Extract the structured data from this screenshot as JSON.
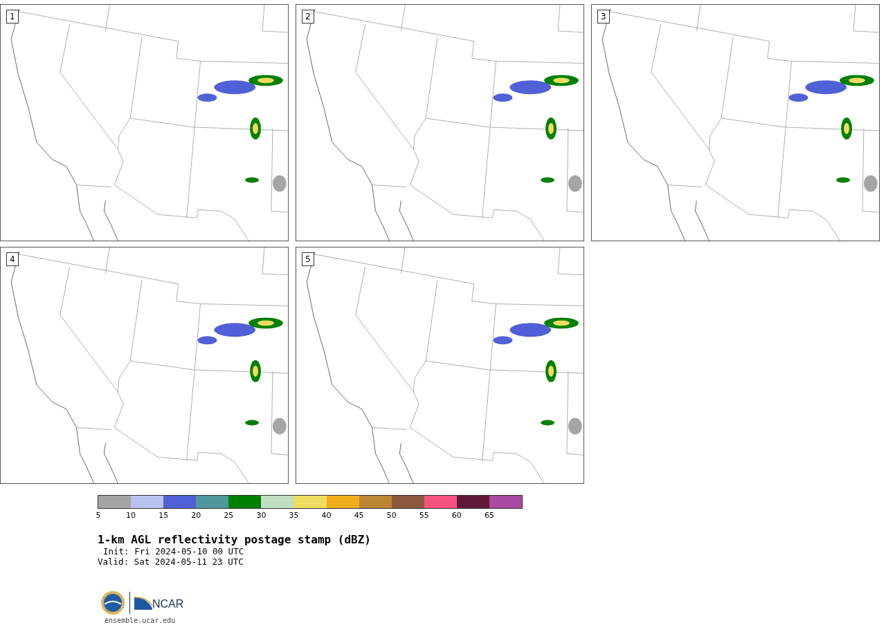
{
  "panels": [
    {
      "number": "1"
    },
    {
      "number": "2"
    },
    {
      "number": "3"
    },
    {
      "number": "4"
    },
    {
      "number": "5"
    }
  ],
  "colorbar": {
    "segments": [
      {
        "color": "#a5a5a5",
        "label": "5"
      },
      {
        "color": "#b8c2ee",
        "label": "10"
      },
      {
        "color": "#5060d6",
        "label": "15"
      },
      {
        "color": "#50979b",
        "label": "20"
      },
      {
        "color": "#008000",
        "label": "25"
      },
      {
        "color": "#c0dfc0",
        "label": "30"
      },
      {
        "color": "#f0dc60",
        "label": "35"
      },
      {
        "color": "#f0ae1a",
        "label": "40"
      },
      {
        "color": "#bb8533",
        "label": "45"
      },
      {
        "color": "#8b5a3e",
        "label": "50"
      },
      {
        "color": "#f55280",
        "label": "55"
      },
      {
        "color": "#611838",
        "label": "60"
      },
      {
        "color": "#aa4aa2",
        "label": "65"
      }
    ]
  },
  "title": "1-km AGL reflectivity postage stamp (dBZ)",
  "init": "Init: Fri 2024-05-10 00 UTC",
  "valid": "Valid: Sat 2024-05-11 23 UTC",
  "logo": {
    "text": "NCAR"
  },
  "url": "ensemble.ucar.edu"
}
